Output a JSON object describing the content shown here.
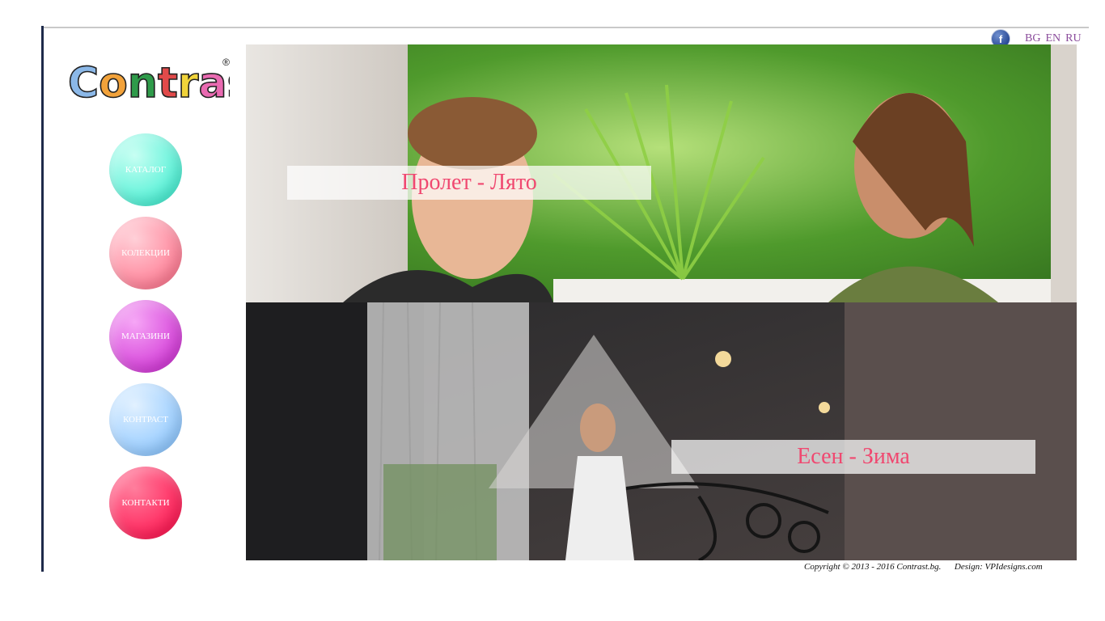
{
  "brand": {
    "logo_text": "Contrast",
    "registered_mark": "®"
  },
  "header": {
    "social": {
      "icon": "facebook-icon",
      "glyph": "f"
    },
    "languages": [
      "BG",
      "EN",
      "RU"
    ]
  },
  "nav": {
    "items": [
      {
        "label": "КАТАЛОГ",
        "color_light": "#c8fff3",
        "color_dark": "#4ff0d5"
      },
      {
        "label": "КОЛЕКЦИИ",
        "color_light": "#ffd0d8",
        "color_dark": "#ff7f96"
      },
      {
        "label": "МАГАЗИНИ",
        "color_light": "#f6a6f6",
        "color_dark": "#d43ed8"
      },
      {
        "label": "КОНТРАСТ",
        "color_light": "#e2f1ff",
        "color_dark": "#93caff"
      },
      {
        "label": "КОНТАКТИ",
        "color_light": "#ff7d9c",
        "color_dark": "#ff1f58"
      }
    ]
  },
  "banners": {
    "spring": {
      "caption": "Пролет - Лято"
    },
    "autumn": {
      "caption": "Есен - Зима"
    }
  },
  "footer": {
    "copyright": "Copyright © 2013 - 2016  Contrast.bg.",
    "design": "Design: VPIdesigns.com"
  },
  "colors": {
    "caption_text": "#f04870",
    "lang_link": "#8a4b9b",
    "frame_left": "#1e2a4a"
  }
}
